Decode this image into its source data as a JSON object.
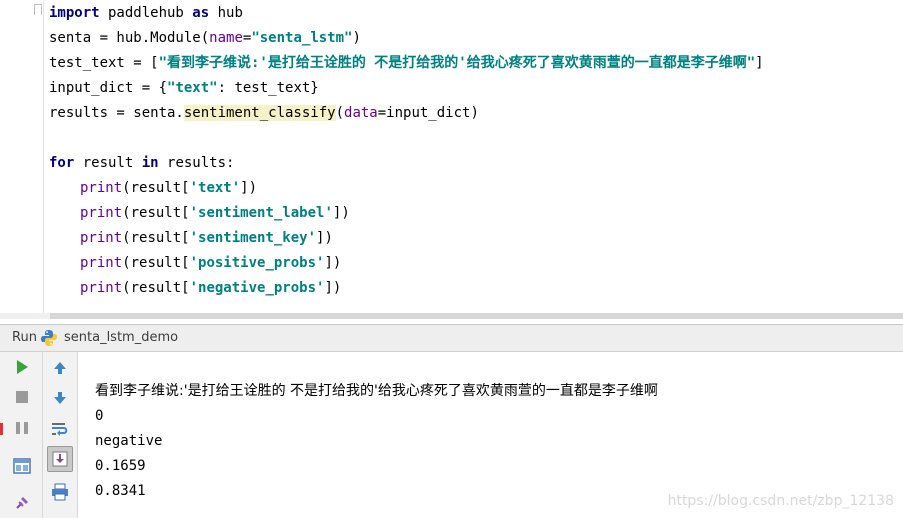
{
  "editor": {
    "lines": {
      "l1": {
        "kw": "import",
        "t1": " paddlehub ",
        "kw2": "as",
        "t2": " hub"
      },
      "l2": {
        "t1": "senta = hub.Module(",
        "param": "name",
        "t2": "=",
        "str": "\"senta_lstm\"",
        "t3": ")"
      },
      "l3": {
        "t1": "test_text = [",
        "str": "\"看到李子维说:'是打给王诠胜的 不是打给我的'给我心疼死了喜欢黄雨萱的一直都是李子维啊\"",
        "t2": "]"
      },
      "l4": {
        "t1": "input_dict = {",
        "str": "\"text\"",
        "t2": ": test_text}"
      },
      "l5": {
        "t1": "results = senta.",
        "method": "sentiment_classify",
        "t2": "(",
        "param": "data",
        "t3": "=input_dict)"
      },
      "l7": {
        "kw": "for",
        "t1": " result ",
        "kw2": "in",
        "t2": " results:"
      },
      "prints": [
        {
          "fn": "print",
          "open": "(result[",
          "key": "'text'",
          "close": "])"
        },
        {
          "fn": "print",
          "open": "(result[",
          "key": "'sentiment_label'",
          "close": "])"
        },
        {
          "fn": "print",
          "open": "(result[",
          "key": "'sentiment_key'",
          "close": "])"
        },
        {
          "fn": "print",
          "open": "(result[",
          "key": "'positive_probs'",
          "close": "])"
        },
        {
          "fn": "print",
          "open": "(result[",
          "key": "'negative_probs'",
          "close": "])"
        }
      ]
    }
  },
  "run_panel": {
    "label": "Run",
    "config_name": "senta_lstm_demo",
    "output": [
      "看到李子维说:'是打给王诠胜的 不是打给我的'给我心疼死了喜欢黄雨萱的一直都是李子维啊",
      "0",
      "negative",
      "0.1659",
      "0.8341"
    ]
  },
  "icons": {
    "rerun": "rerun-icon",
    "stop": "stop-icon",
    "pause": "pause-icon",
    "up": "arrow-up-icon",
    "down": "arrow-down-icon",
    "soft_wrap": "soft-wrap-icon",
    "scroll_to_end": "scroll-to-end-icon",
    "print": "print-icon",
    "layout": "restore-layout-icon",
    "pin": "pin-icon"
  },
  "colors": {
    "keyword": "#000080",
    "string": "#008080",
    "param": "#660099",
    "highlight": "#f6f2c8"
  },
  "watermark": "https://blog.csdn.net/zbp_12138"
}
